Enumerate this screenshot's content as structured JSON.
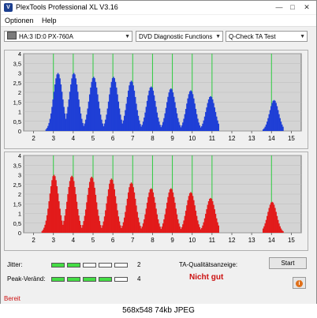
{
  "window": {
    "title": "PlexTools Professional XL V3.16",
    "icon": "plextools-icon",
    "controls": [
      "minimize",
      "maximize",
      "close"
    ]
  },
  "menu": [
    "Optionen",
    "Help"
  ],
  "toolbar": {
    "drive": "HA:3 ID:0  PX-760A",
    "function": "DVD Diagnostic Functions",
    "test": "Q-Check TA Test"
  },
  "chart_data": [
    {
      "type": "bar",
      "title": "",
      "color": "#1f3fd6",
      "ylim": [
        0,
        4
      ],
      "yticks": [
        "4",
        "3,5",
        "3",
        "2,5",
        "2",
        "1,5",
        "1",
        "0,5",
        "0"
      ],
      "xticks": [
        "2",
        "3",
        "4",
        "5",
        "6",
        "7",
        "8",
        "9",
        "10",
        "11",
        "12",
        "13",
        "14",
        "15"
      ],
      "xlim": [
        1.5,
        15.5
      ],
      "grid_lines_at": [
        3,
        4,
        5,
        6,
        7,
        8,
        9,
        10,
        11,
        14
      ],
      "peaks": [
        {
          "x": 3.2,
          "height": 3.0
        },
        {
          "x": 4.0,
          "height": 3.0
        },
        {
          "x": 5.0,
          "height": 2.8
        },
        {
          "x": 6.0,
          "height": 2.8
        },
        {
          "x": 6.9,
          "height": 2.6
        },
        {
          "x": 7.9,
          "height": 2.3
        },
        {
          "x": 8.9,
          "height": 2.2
        },
        {
          "x": 9.9,
          "height": 2.1
        },
        {
          "x": 10.9,
          "height": 1.8
        },
        {
          "x": 14.1,
          "height": 1.6
        }
      ]
    },
    {
      "type": "bar",
      "title": "",
      "color": "#e21b1b",
      "ylim": [
        0,
        4
      ],
      "yticks": [
        "4",
        "3,5",
        "3",
        "2,5",
        "2",
        "1,5",
        "1",
        "0,5",
        "0"
      ],
      "xticks": [
        "2",
        "3",
        "4",
        "5",
        "6",
        "7",
        "8",
        "9",
        "10",
        "11",
        "12",
        "13",
        "14",
        "15"
      ],
      "xlim": [
        1.5,
        15.5
      ],
      "grid_lines_at": [
        3,
        4,
        5,
        6,
        7,
        8,
        9,
        10,
        11,
        14
      ],
      "peaks": [
        {
          "x": 3.0,
          "height": 3.0
        },
        {
          "x": 3.9,
          "height": 2.95
        },
        {
          "x": 4.9,
          "height": 2.9
        },
        {
          "x": 5.9,
          "height": 2.8
        },
        {
          "x": 6.9,
          "height": 2.6
        },
        {
          "x": 7.9,
          "height": 2.3
        },
        {
          "x": 8.9,
          "height": 2.3
        },
        {
          "x": 9.9,
          "height": 2.1
        },
        {
          "x": 10.9,
          "height": 1.8
        },
        {
          "x": 14.0,
          "height": 1.6
        }
      ]
    }
  ],
  "metrics": {
    "jitter_label": "Jitter:",
    "jitter_value": "2",
    "jitter_level": 2,
    "peak_label": "Peak-Veränd:",
    "peak_value": "4",
    "peak_level": 4,
    "segments_total": 5
  },
  "ta": {
    "label": "TA-Qualitätsanzeige:",
    "verdict": "Nicht gut",
    "start_button": "Start",
    "info_icon": "info-icon"
  },
  "status": "Bereit",
  "caption": "568x548 74kb JPEG"
}
